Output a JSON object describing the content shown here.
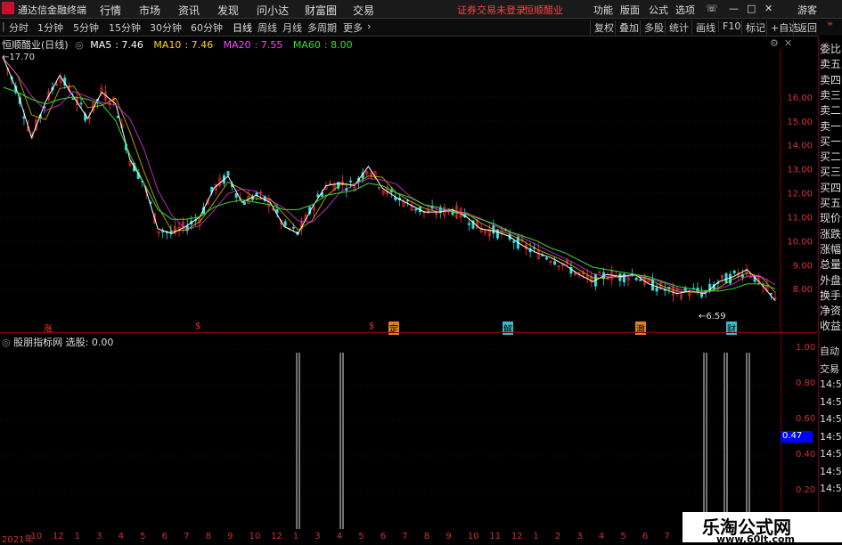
{
  "titlebar": {
    "app_name": "通达信金融终端",
    "menu": [
      "行情",
      "市场",
      "资讯",
      "发现",
      "问小达",
      "财富圈",
      "交易"
    ],
    "login_notice": "证券交易未登录",
    "stock_name": "恒顺醋业",
    "right_menu": [
      "功能",
      "版面",
      "公式",
      "选项"
    ],
    "guest": "游客"
  },
  "toolbar": {
    "periods": [
      "分时",
      "1分钟",
      "5分钟",
      "15分钟",
      "30分钟",
      "60分钟",
      "日线",
      "周线",
      "月线",
      "多周期",
      "更多"
    ],
    "active_period": "日线",
    "right_buttons": [
      "复权",
      "叠加",
      "多股",
      "统计",
      "画线",
      "F10",
      "标记",
      "+自选",
      "返回"
    ]
  },
  "main_chart": {
    "title": "恒顺醋业(日线)",
    "ma": [
      {
        "name": "MA5",
        "value": "7.46",
        "color": "#ffffff"
      },
      {
        "name": "MA10",
        "value": "7.46",
        "color": "#ffd800"
      },
      {
        "name": "MA20",
        "value": "7.55",
        "color": "#ff44ff"
      },
      {
        "name": "MA60",
        "value": "8.00",
        "color": "#33dd33"
      }
    ],
    "high_label": "17.70",
    "low_label": "6.59",
    "yticks": [
      "16.00",
      "15.00",
      "14.00",
      "13.00",
      "12.00",
      "11.00",
      "10.00",
      "9.00",
      "8.00"
    ],
    "signals": [
      "涨",
      "$",
      "$",
      "定",
      "解",
      "澈",
      "财"
    ]
  },
  "right_panel": {
    "labels": [
      "委比",
      "卖五",
      "卖四",
      "卖三",
      "卖二",
      "卖一",
      "买一",
      "买二",
      "买三",
      "买四",
      "买五",
      "现价",
      "涨跌",
      "涨幅",
      "总量",
      "外盘",
      "换手",
      "净资",
      "收益"
    ],
    "lower_labels": [
      "自动",
      "交易",
      "14:56",
      "14:56",
      "14:56",
      "14:56",
      "14:56",
      "14:56",
      "14:56"
    ]
  },
  "indicator": {
    "title": "股朋指标网",
    "select_label": "选股:",
    "select_value": "0.00",
    "yticks": [
      "1.00",
      "0.80",
      "0.60",
      "0.40",
      "0.20"
    ],
    "current_value": "0.47"
  },
  "x_axis": {
    "ticks": [
      "2021年",
      "10",
      "12",
      "1",
      "3",
      "4",
      "5",
      "6",
      "7",
      "8",
      "9",
      "10",
      "12",
      "1",
      "3",
      "4",
      "5",
      "6",
      "7",
      "8",
      "9",
      "10",
      "11",
      "12",
      "1",
      "2",
      "3",
      "4",
      "5",
      "6",
      "7",
      "8"
    ]
  },
  "watermark": {
    "title": "乐淘公式网",
    "url": "www.60lt.com"
  },
  "colors": {
    "background": "#000000",
    "axis": "#cc3333",
    "price_line": "#e0e0e0",
    "up": "#ff3333",
    "down": "#33dddd"
  },
  "chart_data": {
    "type": "line",
    "title": "恒顺醋业(日线)",
    "ylim": [
      6.3,
      18.0
    ],
    "series": [
      {
        "name": "MA5",
        "values": [
          17.6,
          16.2,
          14.3,
          15.8,
          16.9,
          16.0,
          15.1,
          16.2,
          15.7,
          13.4,
          12.4,
          10.5,
          10.3,
          10.6,
          11.0,
          12.2,
          12.7,
          11.6,
          11.9,
          11.6,
          10.6,
          10.3,
          11.4,
          12.3,
          12.4,
          12.3,
          13.1,
          12.2,
          11.8,
          11.5,
          11.2,
          11.2,
          11.3,
          11.0,
          10.5,
          10.4,
          10.2,
          9.8,
          9.5,
          9.3,
          9.0,
          8.6,
          8.3,
          8.6,
          8.5,
          8.6,
          8.2,
          8.0,
          7.8,
          7.9,
          7.8,
          8.3,
          8.5,
          8.8,
          8.2,
          7.5
        ]
      },
      {
        "name": "MA60",
        "values": [
          16.4,
          16.2,
          15.9,
          15.7,
          15.9,
          16.0,
          15.9,
          15.7,
          15.0,
          13.6,
          12.4,
          11.3,
          10.9,
          10.9,
          11.0,
          11.4,
          11.6,
          11.7,
          11.6,
          11.5,
          11.3,
          11.3,
          11.5,
          11.9,
          12.0,
          12.1,
          12.4,
          12.3,
          12.0,
          11.8,
          11.5,
          11.4,
          11.2,
          11.1,
          10.9,
          10.7,
          10.4,
          10.2,
          10.0,
          9.7,
          9.5,
          9.2,
          8.9,
          8.8,
          8.7,
          8.6,
          8.5,
          8.3,
          8.1,
          8.0,
          7.9,
          7.9,
          8.0,
          8.2,
          8.2,
          8.0
        ]
      }
    ],
    "indicator_spikes": [
      0.98,
      0.98,
      0.98,
      0.98,
      0.98
    ]
  }
}
